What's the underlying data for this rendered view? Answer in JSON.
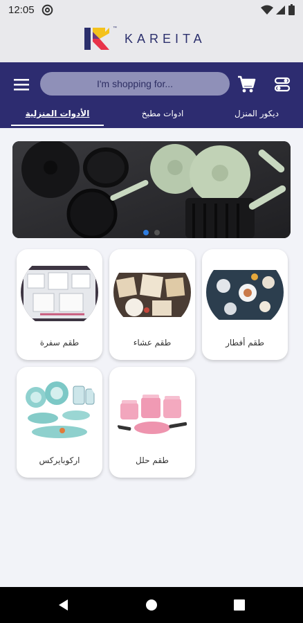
{
  "status": {
    "time": "12:05"
  },
  "brand": {
    "name": "KAREITA",
    "tm": "™",
    "colors": {
      "navy": "#2b2f6c",
      "red": "#e8334a",
      "yellow": "#f4c21c"
    }
  },
  "header": {
    "search_placeholder": "I'm shopping for...",
    "icons": [
      "menu-icon",
      "cart-icon",
      "filter-icon"
    ],
    "color": "#2d2c70"
  },
  "tabs": [
    {
      "label": "الأدوات المنزلية",
      "active": true
    },
    {
      "label": "ادوات مطبخ",
      "active": false
    },
    {
      "label": "ديكور المنزل",
      "active": false
    }
  ],
  "banner": {
    "slides": 2,
    "active_slide": 1
  },
  "categories": [
    {
      "label": "طقم أفطار",
      "icon": "breakfast-set-image"
    },
    {
      "label": "طقم عشاء",
      "icon": "dinner-set-image"
    },
    {
      "label": "طقم سفرة",
      "icon": "dining-set-image"
    },
    {
      "label": "طقم حلل",
      "icon": "cookware-set-image"
    },
    {
      "label": "اركوبايركس",
      "icon": "arcopyrex-set-image"
    }
  ]
}
